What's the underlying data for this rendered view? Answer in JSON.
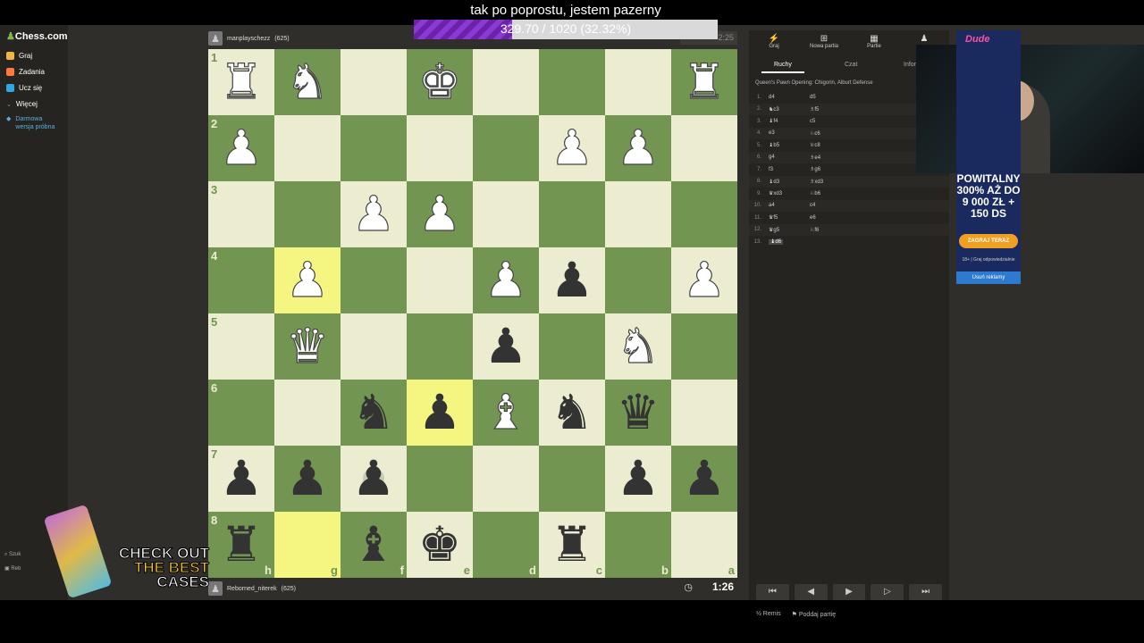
{
  "stream": {
    "title": "tak po poprostu, jestem pazerny",
    "progress_text": "329.70 / 1020 (32.32%)",
    "progress_fraction": 0.3232
  },
  "nav": {
    "logo": "Chess.com",
    "items": [
      {
        "label": "Graj",
        "color": "#f0b542"
      },
      {
        "label": "Zadania",
        "color": "#ff7a3c"
      },
      {
        "label": "Ucz się",
        "color": "#33a5e0"
      },
      {
        "label": "Więcej",
        "color": "#999999"
      }
    ],
    "trial": "Darmowa wersja próbna",
    "bottom_search": "Szuk",
    "bottom_user": "Reb"
  },
  "players": {
    "top": {
      "name": "manplayschezz",
      "rating": "(625)",
      "clock": "2:25"
    },
    "bottom": {
      "name": "Reborned_niterek",
      "rating": "(625)",
      "clock": "1:26"
    }
  },
  "board": {
    "rank_labels": [
      "1",
      "2",
      "3",
      "4",
      "5",
      "6",
      "7",
      "8"
    ],
    "file_labels": [
      "h",
      "g",
      "f",
      "e",
      "d",
      "c",
      "b",
      "a"
    ],
    "rows": [
      [
        "wR",
        "wN",
        "",
        "wK",
        "",
        "",
        "",
        "wR"
      ],
      [
        "wP",
        "",
        "",
        "",
        "",
        "wP",
        "wP",
        ""
      ],
      [
        "",
        "",
        "wP",
        "wP",
        "",
        "",
        "",
        ""
      ],
      [
        "",
        "wP",
        "",
        "",
        "wP",
        "bP",
        "",
        "wP"
      ],
      [
        "",
        "wQ",
        "",
        "",
        "bP",
        "",
        "wN",
        ""
      ],
      [
        "",
        "",
        "bN",
        "bP",
        "wB",
        "bN",
        "bQ",
        ""
      ],
      [
        "bP",
        "bP",
        "bP",
        "",
        "",
        "",
        "bP",
        "bP"
      ],
      [
        "bR",
        "",
        "bB",
        "bK",
        "",
        "bR",
        "",
        ""
      ]
    ],
    "highlight": [
      "4-2",
      "6-4",
      "8-2"
    ],
    "hint": "7-3"
  },
  "panel": {
    "tabs": [
      {
        "icon": "bolt-icon",
        "glyph": "⚡",
        "label": "Graj"
      },
      {
        "icon": "plus-square-icon",
        "glyph": "⊞",
        "label": "Nowa partia"
      },
      {
        "icon": "grid-icon",
        "glyph": "▦",
        "label": "Partie"
      },
      {
        "icon": "players-icon",
        "glyph": "♟",
        "label": ""
      }
    ],
    "subtabs": [
      "Ruchy",
      "Czat",
      "Infor"
    ],
    "opening": "Queen's Pawn Opening: Chigorin, Alburt Defense",
    "moves": [
      {
        "n": "1.",
        "w": "d4",
        "b": "d5"
      },
      {
        "n": "2.",
        "w": "♞c3",
        "b": "♗f5"
      },
      {
        "n": "3.",
        "w": "♝f4",
        "b": "c5"
      },
      {
        "n": "4.",
        "w": "e3",
        "b": "♘c6"
      },
      {
        "n": "5.",
        "w": "♝b5",
        "b": "♕c8"
      },
      {
        "n": "6.",
        "w": "g4",
        "b": "♗e4"
      },
      {
        "n": "7.",
        "w": "f3",
        "b": "♗g6"
      },
      {
        "n": "8.",
        "w": "♝d3",
        "b": "♗xd3"
      },
      {
        "n": "9.",
        "w": "♛xd3",
        "b": "♘b6"
      },
      {
        "n": "10.",
        "w": "a4",
        "b": "c4"
      },
      {
        "n": "11.",
        "w": "♛f5",
        "b": "e6"
      },
      {
        "n": "12.",
        "w": "♛g5",
        "b": "♘f6"
      },
      {
        "n": "13.",
        "w": "♝d6",
        "b": ""
      }
    ],
    "nav_buttons": [
      "⏮",
      "◀",
      "▶",
      "▷",
      "⏭"
    ],
    "draw": "Remis",
    "resign": "Poddaj partię"
  },
  "ad": {
    "brand": "Dude",
    "headline": "POWITALNY 300% AŻ DO 9 000 ZŁ + 150 DS",
    "cta": "ZAGRAJ TERAZ",
    "small": "18+ | Graj odpowiedzialnie",
    "remove": "Usuń reklamy"
  },
  "promo": {
    "line1": "CHECK OUT",
    "line2": "THE BEST",
    "line3": "CASES"
  }
}
